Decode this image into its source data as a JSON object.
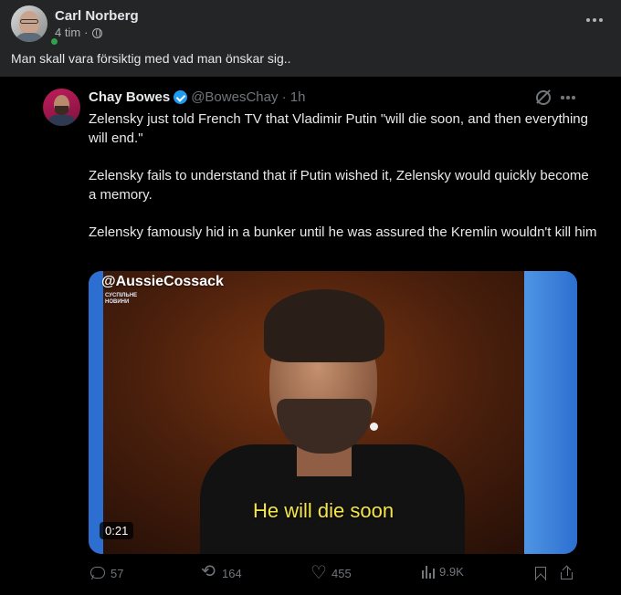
{
  "fb_post": {
    "author": "Carl Norberg",
    "time": "4 tim",
    "separator": "·",
    "privacy_icon": "globe-icon",
    "more_icon": "more-horizontal-icon",
    "text": "Man skall vara försiktig med vad man önskar sig.."
  },
  "tweet": {
    "author_name": "Chay Bowes",
    "verified_icon": "verified-badge-icon",
    "handle_time": "@BowesChay · 1h",
    "paragraphs": [
      "Zelensky just told French TV that Vladimir Putin \"will die soon, and then everything will end.\"",
      "Zelensky fails to understand that if Putin wished it, Zelensky would quickly become a memory.",
      "Zelensky famously hid in a bunker until he was assured the Kremlin wouldn't kill him"
    ],
    "video": {
      "watermark": "@AussieCossack",
      "channel_logo": "СУСПІЛЬНЕ НОВИНИ",
      "caption": "He will die soon",
      "duration": "0:21"
    },
    "actions": {
      "replies": "57",
      "retweets": "164",
      "likes": "455",
      "views": "9.9K"
    },
    "colors": {
      "accent": "#1d9bf0",
      "muted": "#71767b",
      "caption": "#f4e64a"
    }
  }
}
